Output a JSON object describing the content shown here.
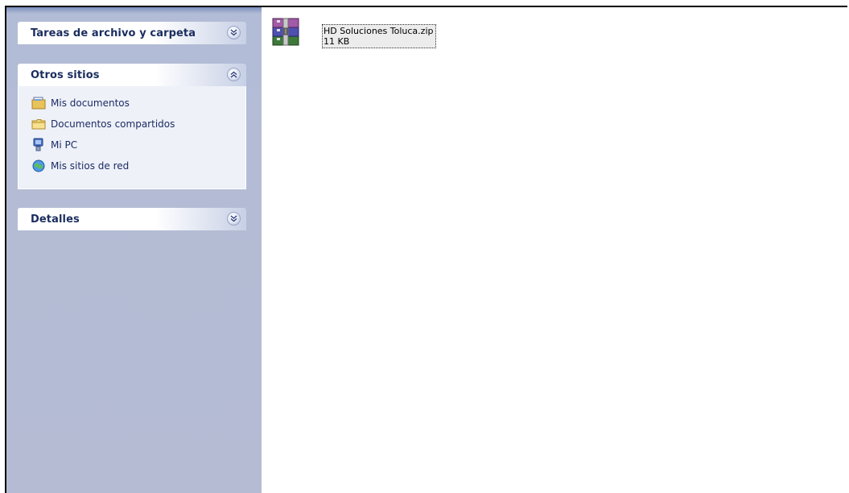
{
  "taskpane": {
    "panels": [
      {
        "title": "Tareas de archivo y carpeta",
        "expanded": false
      },
      {
        "title": "Otros sitios",
        "expanded": true,
        "items": [
          {
            "label": "Mis documentos",
            "icon": "my-documents-icon"
          },
          {
            "label": "Documentos compartidos",
            "icon": "folder-icon"
          },
          {
            "label": "Mi PC",
            "icon": "my-computer-icon"
          },
          {
            "label": "Mis sitios de red",
            "icon": "network-places-icon"
          }
        ]
      },
      {
        "title": "Detalles",
        "expanded": false
      }
    ]
  },
  "files": [
    {
      "name": "HD Soluciones Toluca.zip",
      "size": "11 KB",
      "icon": "zip-archive-icon"
    }
  ]
}
